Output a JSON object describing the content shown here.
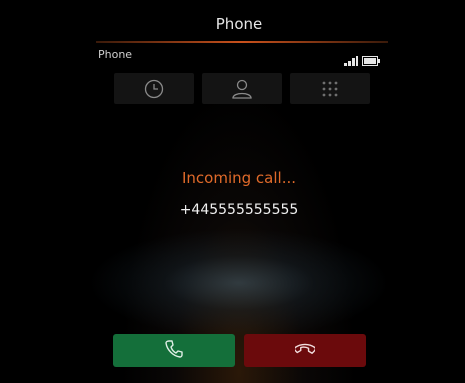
{
  "app": {
    "title": "Phone",
    "subtitle": "Phone"
  },
  "status": {
    "signal_icon": "signal-bars-icon",
    "battery_icon": "battery-icon"
  },
  "tabs": [
    {
      "name": "recent-calls",
      "icon": "clock-icon"
    },
    {
      "name": "contacts",
      "icon": "person-icon"
    },
    {
      "name": "keypad",
      "icon": "keypad-icon"
    }
  ],
  "call": {
    "state_text": "Incoming call...",
    "number": "+445555555555"
  },
  "actions": {
    "accept_icon": "phone-accept-icon",
    "reject_icon": "phone-reject-icon"
  },
  "colors": {
    "accent": "#e06a2a",
    "accept": "#146f3a",
    "reject": "#6b0a0c"
  }
}
